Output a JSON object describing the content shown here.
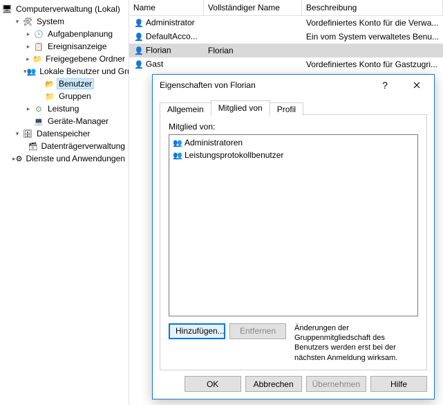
{
  "tree": {
    "root": "Computerverwaltung (Lokal)",
    "system": "System",
    "task": "Aufgabenplanung",
    "event": "Ereignisanzeige",
    "share": "Freigegebene Ordner",
    "localusers": "Lokale Benutzer und Gruppen",
    "users": "Benutzer",
    "groups": "Gruppen",
    "perf": "Leistung",
    "dev": "Geräte-Manager",
    "storage": "Datenspeicher",
    "disk": "Datenträgerverwaltung",
    "svc": "Dienste und Anwendungen"
  },
  "columns": {
    "name": "Name",
    "full": "Vollständiger Name",
    "desc": "Beschreibung"
  },
  "rows": [
    {
      "name": "Administrator",
      "full": "",
      "desc": "Vordefiniertes Konto für die Verwa..."
    },
    {
      "name": "DefaultAcco...",
      "full": "",
      "desc": "Ein vom System verwaltetes Benu..."
    },
    {
      "name": "Florian",
      "full": "Florian",
      "desc": ""
    },
    {
      "name": "Gast",
      "full": "",
      "desc": "Vordefiniertes Konto für Gastzugri..."
    }
  ],
  "dialog": {
    "title": "Eigenschaften von Florian",
    "tabs": {
      "general": "Allgemein",
      "memberof": "Mitglied von",
      "profile": "Profil"
    },
    "memberof_label": "Mitglied von:",
    "members": [
      "Administratoren",
      "Leistungsprotokollbenutzer"
    ],
    "add": "Hinzufügen...",
    "remove": "Entfernen",
    "note": "Änderungen der Gruppenmitgliedschaft des Benutzers werden erst bei der nächsten Anmeldung wirksam.",
    "ok": "OK",
    "cancel": "Abbrechen",
    "apply": "Übernehmen",
    "help": "Hilfe"
  }
}
